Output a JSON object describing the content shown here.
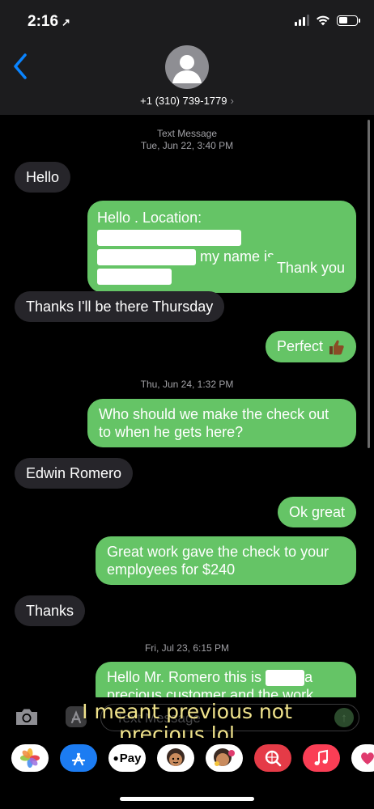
{
  "status": {
    "time": "2:16",
    "location_arrow": "↗",
    "battery_level": 0.5
  },
  "header": {
    "back_icon": "chevron-left-icon",
    "contact": "+1 (310) 739-1779",
    "contact_chevron": "›"
  },
  "timestamps": [
    {
      "label": "Text Message",
      "time": "Tue, Jun 22, 3:40 PM"
    },
    {
      "time": "Thu, Jun 24, 1:32 PM"
    },
    {
      "time": "Fri, Jul 23, 6:15 PM"
    }
  ],
  "messages": [
    {
      "dir": "in",
      "text": "Hello"
    },
    {
      "dir": "out",
      "line1": "Hello . Location:",
      "line2": "my name is"
    },
    {
      "dir": "out",
      "text": "Thank you"
    },
    {
      "dir": "in",
      "text": "Thanks I'll be there Thursday"
    },
    {
      "dir": "out",
      "text": "Perfect"
    },
    {
      "dir": "out",
      "text": "Who should we make the check out to when he gets here?"
    },
    {
      "dir": "in",
      "text": "Edwin Romero"
    },
    {
      "dir": "out",
      "text": "Ok great"
    },
    {
      "dir": "out",
      "text": "Great work gave the check to your employees for  $240"
    },
    {
      "dir": "in",
      "text": "Thanks"
    },
    {
      "dir": "out",
      "line1": "Hello Mr. Romero this is",
      "line1_end": "a",
      "line2": "precious customer and the work"
    }
  ],
  "input": {
    "placeholder": "Text Message"
  },
  "caption": {
    "line1": "I meant previous not",
    "line2": "precious lol…"
  },
  "apps": [
    "photos-icon",
    "app-store-icon",
    "apple-pay-icon",
    "memoji-icon",
    "memoji-stickers-icon",
    "search-images-icon",
    "music-icon",
    "heart-icon"
  ],
  "apple_pay_label": "Pay",
  "colors": {
    "outgoing": "#65c466",
    "incoming": "#26252a",
    "header": "#1c1c1e",
    "link": "#0a84ff",
    "caption": "#f0e38c"
  }
}
